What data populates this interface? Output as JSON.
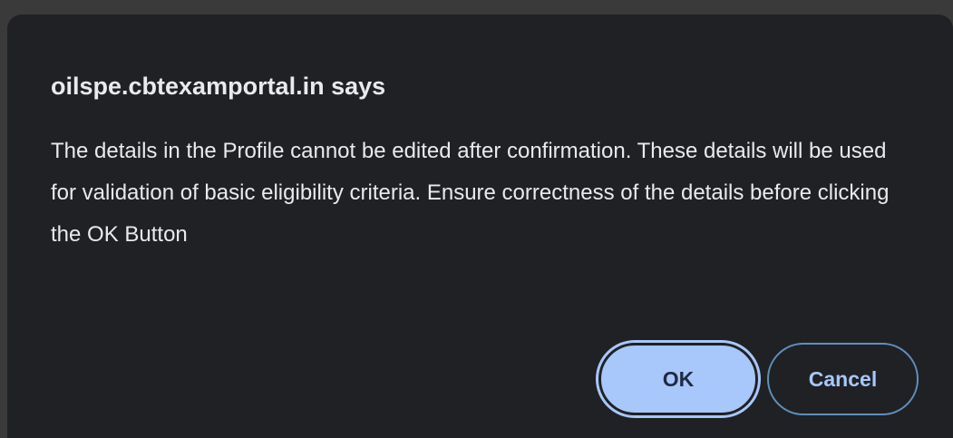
{
  "dialog": {
    "title": "oilspe.cbtexamportal.in says",
    "message": "The details in the Profile cannot be edited after confirmation. These details will be used for validation of basic eligibility criteria. Ensure correctness of the details before clicking the OK Button",
    "ok_label": "OK",
    "cancel_label": "Cancel"
  },
  "colors": {
    "dialog_background": "#202124",
    "text": "#e8eaed",
    "accent": "#a8c7fa"
  }
}
